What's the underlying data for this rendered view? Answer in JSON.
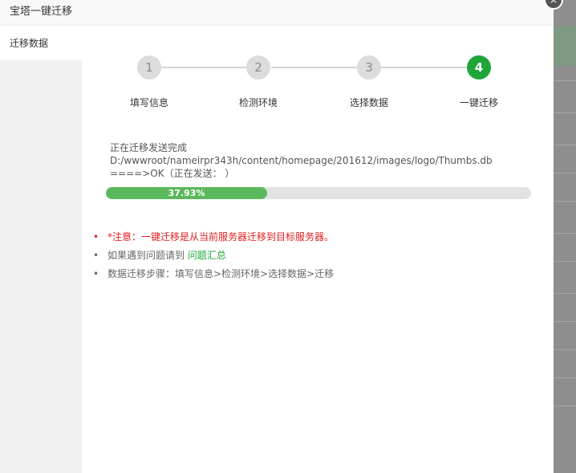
{
  "window": {
    "title": "宝塔一键迁移",
    "close_label": "×"
  },
  "sidebar": {
    "items": [
      {
        "label": "迁移数据"
      }
    ]
  },
  "steps": [
    {
      "number": "1",
      "label": "填写信息",
      "active": false
    },
    {
      "number": "2",
      "label": "检测环境",
      "active": false
    },
    {
      "number": "3",
      "label": "选择数据",
      "active": false
    },
    {
      "number": "4",
      "label": "一键迁移",
      "active": true
    }
  ],
  "status": {
    "line1": "正在迁移发送完成",
    "line2": "D:/wwwroot/nameirpr343h/content/homepage/201612/images/logo/Thumbs.db",
    "line3": "====>OK（正在发送：  ）"
  },
  "progress": {
    "percent": 37.93,
    "label": "37.93%"
  },
  "notes": {
    "warning": "*注意：一键迁移是从当前服务器迁移到目标服务器。",
    "help_prefix": "如果遇到问题请到 ",
    "help_link": "问题汇总",
    "steps_text": "数据迁移步骤：填写信息>检测环境>选择数据>迁移"
  },
  "colors": {
    "accent": "#20a53a",
    "progress": "#5cb85c",
    "warning": "#e02020"
  }
}
